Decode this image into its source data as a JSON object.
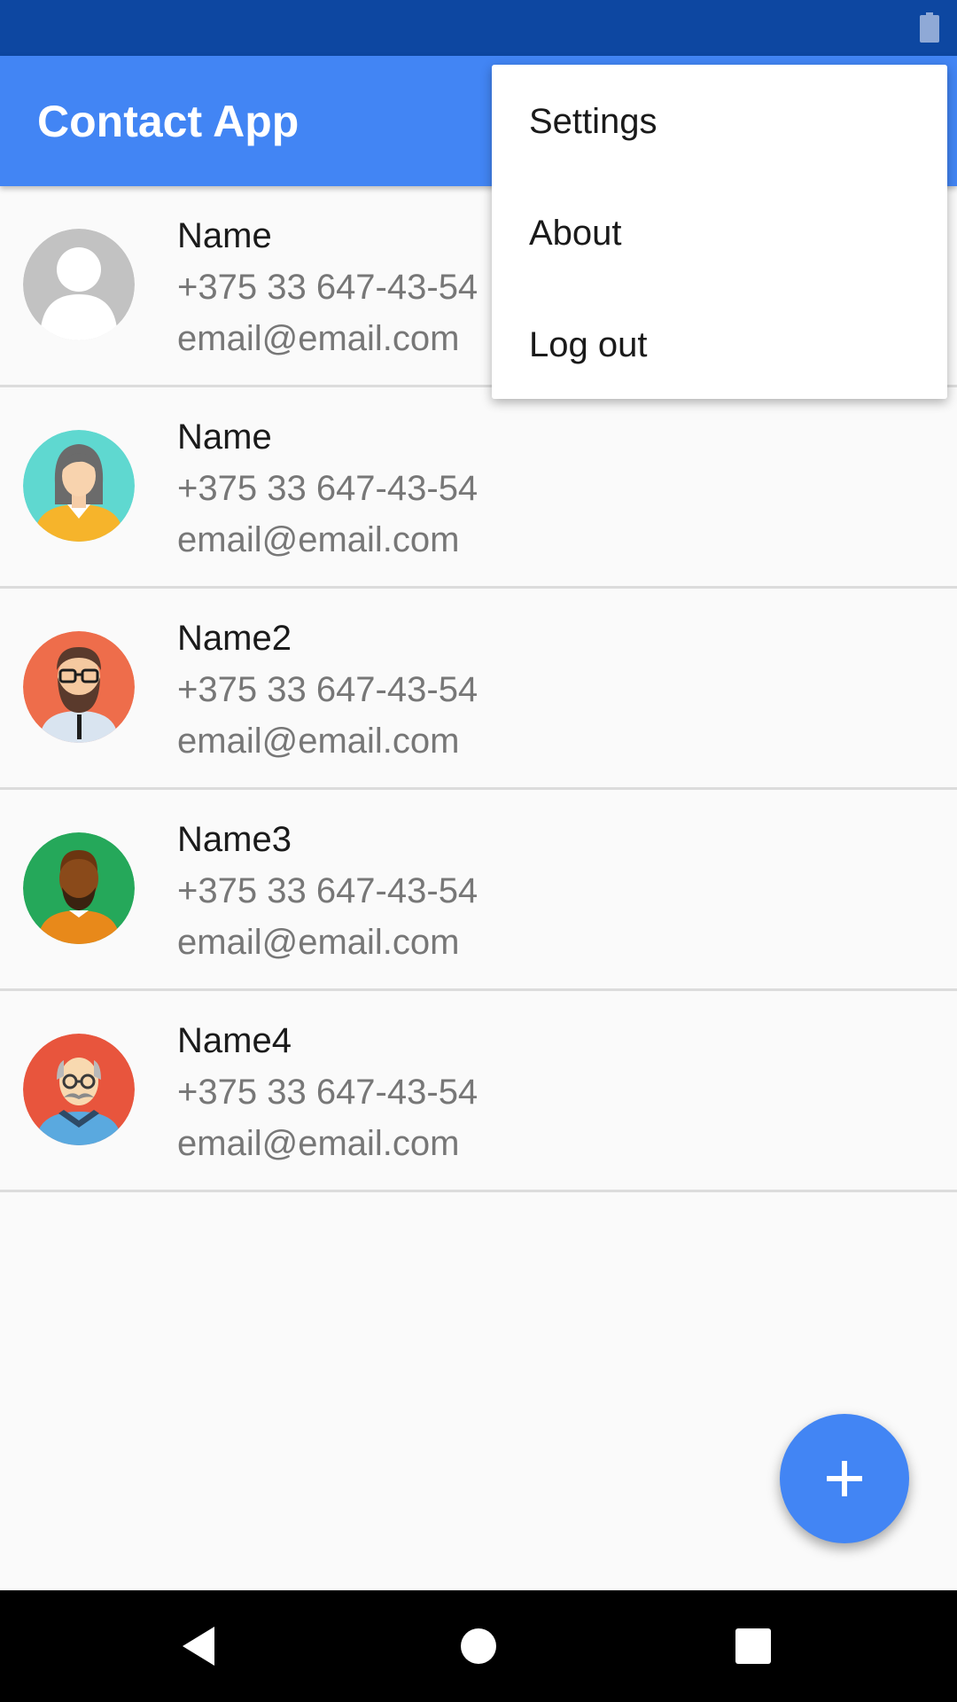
{
  "app": {
    "title": "Contact App"
  },
  "colors": {
    "primary": "#4285f4",
    "primary_dark": "#0d47a1"
  },
  "status_bar": {
    "icons": [
      "battery-icon"
    ]
  },
  "contacts": [
    {
      "name": "Name",
      "phone": "+375 33 647-43-54",
      "email": "email@email.com",
      "avatar": "default-person-avatar"
    },
    {
      "name": "Name",
      "phone": "+375 33 647-43-54",
      "email": "email@email.com",
      "avatar": "woman-avatar"
    },
    {
      "name": "Name2",
      "phone": "+375 33 647-43-54",
      "email": "email@email.com",
      "avatar": "bearded-man-glasses-avatar"
    },
    {
      "name": "Name3",
      "phone": "+375 33 647-43-54",
      "email": "email@email.com",
      "avatar": "bearded-man-avatar"
    },
    {
      "name": "Name4",
      "phone": "+375 33 647-43-54",
      "email": "email@email.com",
      "avatar": "old-man-mustache-avatar"
    }
  ],
  "overflow_menu": {
    "items": [
      "Settings",
      "About",
      "Log out"
    ]
  },
  "fab": {
    "icon": "plus-icon"
  },
  "navigation": {
    "icons": [
      "back-icon",
      "home-icon",
      "recents-icon"
    ]
  }
}
